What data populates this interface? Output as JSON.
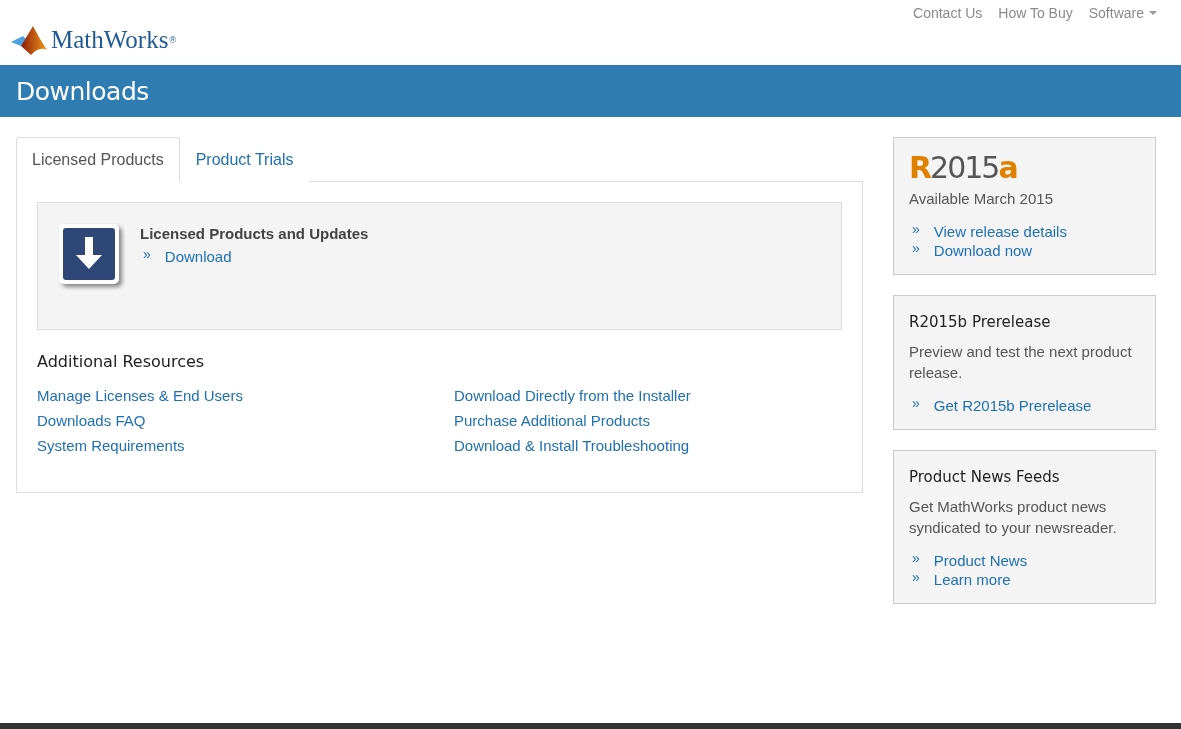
{
  "header": {
    "logo_text": "MathWorks",
    "registered_mark": "®",
    "nav": [
      {
        "label": "Contact Us",
        "dropdown": false
      },
      {
        "label": "How To Buy",
        "dropdown": false
      },
      {
        "label": "Software",
        "dropdown": true
      }
    ]
  },
  "banner": {
    "title": "Downloads"
  },
  "tabs": [
    {
      "label": "Licensed Products",
      "selected": true
    },
    {
      "label": "Product Trials",
      "selected": false
    }
  ],
  "download_card": {
    "title": "Licensed Products and Updates",
    "links": [
      {
        "marker": "»",
        "label": "Download"
      }
    ]
  },
  "additional_resources": {
    "title": "Additional Resources",
    "links": [
      {
        "label": "Manage Licenses & End Users"
      },
      {
        "label": "Download Directly from the Installer"
      },
      {
        "label": "Downloads FAQ"
      },
      {
        "label": "Purchase Additional Products"
      },
      {
        "label": "System Requirements"
      },
      {
        "label": "Download & Install Troubleshooting"
      }
    ]
  },
  "sidebar": [
    {
      "kind": "release",
      "release": {
        "prefix": "R",
        "number": "2015",
        "suffix": "a"
      },
      "text": "Available March 2015",
      "links": [
        {
          "marker": "»",
          "label": "View release details"
        },
        {
          "marker": "»",
          "label": "Download now"
        }
      ]
    },
    {
      "kind": "panel",
      "title": "R2015b Prerelease",
      "text": "Preview and test the next product release.",
      "links": [
        {
          "marker": "»",
          "label": "Get R2015b Prerelease"
        }
      ]
    },
    {
      "kind": "panel",
      "title": "Product News Feeds",
      "text": "Get MathWorks product news syndicated to your newsreader.",
      "links": [
        {
          "marker": "»",
          "label": "Product News"
        },
        {
          "marker": "»",
          "label": "Learn more"
        }
      ]
    }
  ]
}
